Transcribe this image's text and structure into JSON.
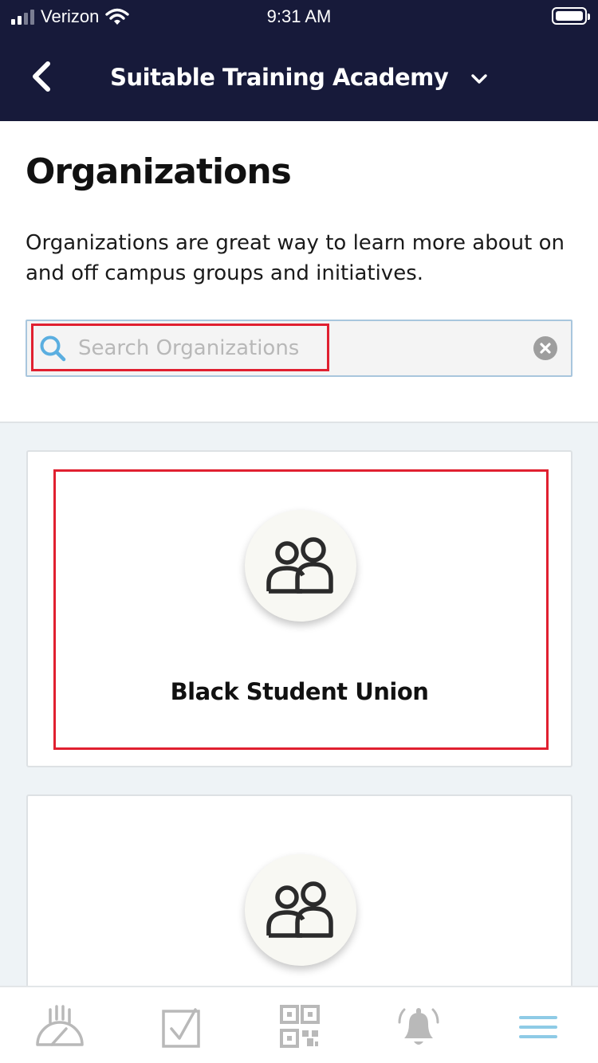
{
  "status_bar": {
    "carrier": "Verizon",
    "time": "9:31 AM"
  },
  "navbar": {
    "title": "Suitable Training Academy"
  },
  "page": {
    "title": "Organizations",
    "description": "Organizations are great way to learn more about on and off campus groups and initiatives."
  },
  "search": {
    "placeholder": "Search Organizations",
    "value": ""
  },
  "organizations": [
    {
      "name": "Black Student Union"
    },
    {
      "name": ""
    }
  ],
  "tab_bar": {
    "items": [
      {
        "icon": "dashboard-gauge-icon"
      },
      {
        "icon": "checkbox-icon"
      },
      {
        "icon": "qr-code-icon"
      },
      {
        "icon": "bell-icon"
      },
      {
        "icon": "menu-icon",
        "active": true
      }
    ]
  },
  "colors": {
    "nav_background": "#171a3a",
    "highlight_border": "#e02030",
    "search_icon": "#5aaee0",
    "active_tab": "#8ecbe6",
    "inactive_tab": "#b9b9b9"
  }
}
